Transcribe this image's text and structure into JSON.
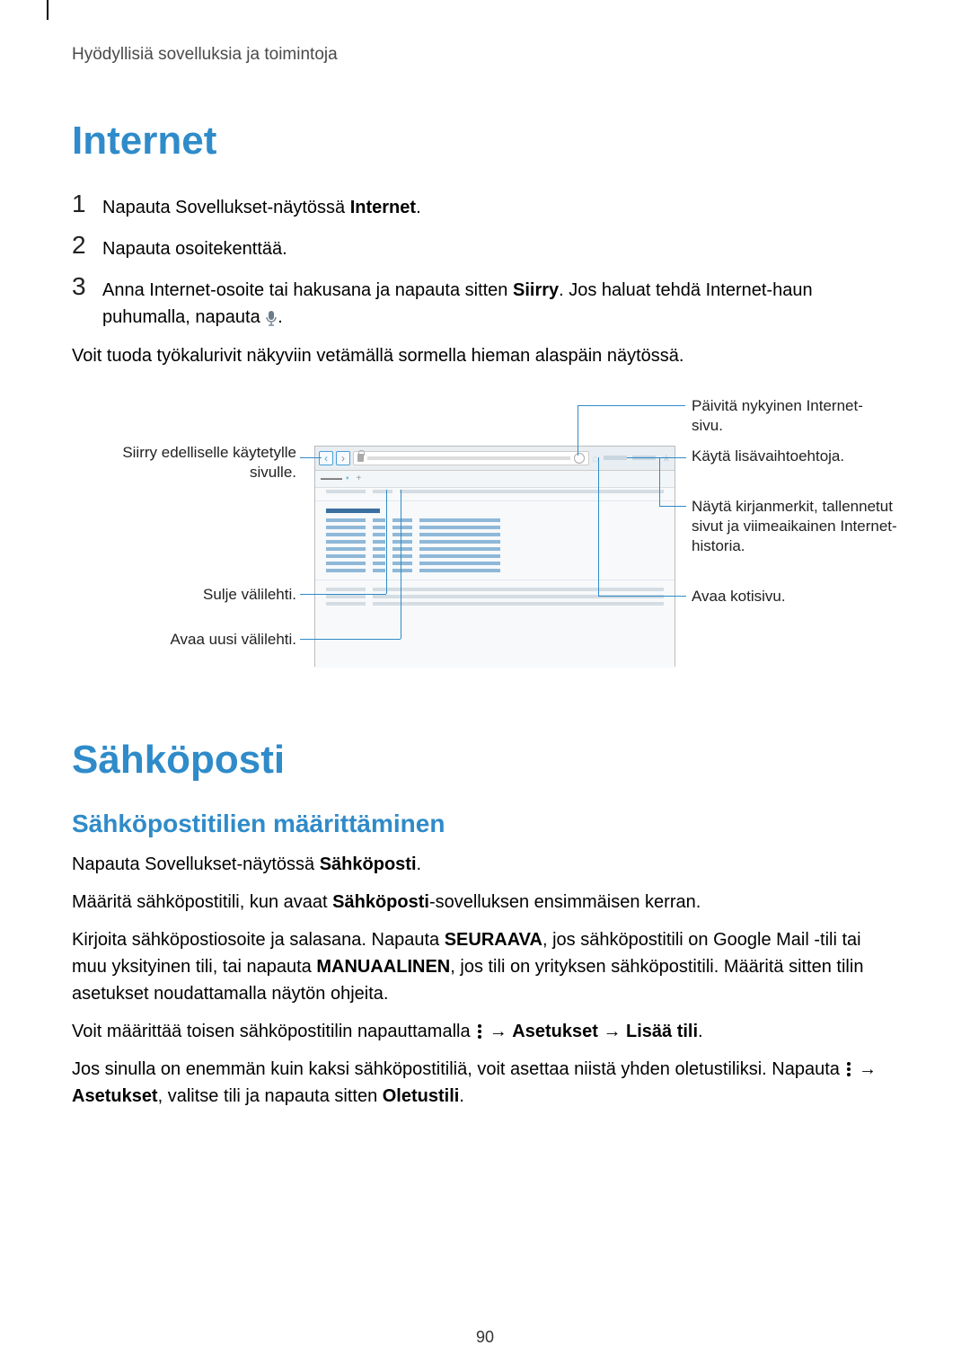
{
  "header": "Hyödyllisiä sovelluksia ja toimintoja",
  "section1": {
    "title": "Internet",
    "step1_pre": "Napauta Sovellukset-näytössä ",
    "step1_bold": "Internet",
    "step1_post": ".",
    "step2": "Napauta osoitekenttää.",
    "step3_pre": "Anna Internet-osoite tai hakusana ja napauta sitten ",
    "step3_bold": "Siirry",
    "step3_post1": ". Jos haluat tehdä Internet-haun puhumalla, napauta ",
    "step3_post2": ".",
    "after_list": "Voit tuoda työkalurivit näkyviin vetämällä sormella hieman alaspäin näytössä."
  },
  "callouts": {
    "prev_page": "Siirry edelliselle käytetylle sivulle.",
    "close_tab": "Sulje välilehti.",
    "new_tab": "Avaa uusi välilehti.",
    "refresh": "Päivitä nykyinen Internet-sivu.",
    "more_opts": "Käytä lisävaihtoehtoja.",
    "bookmarks": "Näytä kirjanmerkit, tallennetut sivut ja viimeaikainen Internet-historia.",
    "home": "Avaa kotisivu."
  },
  "section2": {
    "title": "Sähköposti",
    "subheading": "Sähköpostitilien määrittäminen",
    "p1_pre": "Napauta Sovellukset-näytössä ",
    "p1_bold": "Sähköposti",
    "p1_post": ".",
    "p2_pre": "Määritä sähköpostitili, kun avaat ",
    "p2_bold": "Sähköposti",
    "p2_post": "-sovelluksen ensimmäisen kerran.",
    "p3_pre": "Kirjoita sähköpostiosoite ja salasana. Napauta ",
    "p3_b1": "SEURAAVA",
    "p3_mid": ", jos sähköpostitili on Google Mail -tili tai muu yksityinen tili, tai napauta ",
    "p3_b2": "MANUAALINEN",
    "p3_post": ", jos tili on yrityksen sähköpostitili. Määritä sitten tilin asetukset noudattamalla näytön ohjeita.",
    "p4_pre": "Voit määrittää toisen sähköpostitilin napauttamalla ",
    "p4_arrow1": " → ",
    "p4_b1": "Asetukset",
    "p4_arrow2": " → ",
    "p4_b2": "Lisää tili",
    "p4_post": ".",
    "p5_pre": "Jos sinulla on enemmän kuin kaksi sähköpostitiliä, voit asettaa niistä yhden oletustiliksi. Napauta ",
    "p5_arrow1": " → ",
    "p5_b1": "Asetukset",
    "p5_mid": ", valitse tili ja napauta sitten ",
    "p5_b2": "Oletustili",
    "p5_post": "."
  },
  "page_number": "90"
}
